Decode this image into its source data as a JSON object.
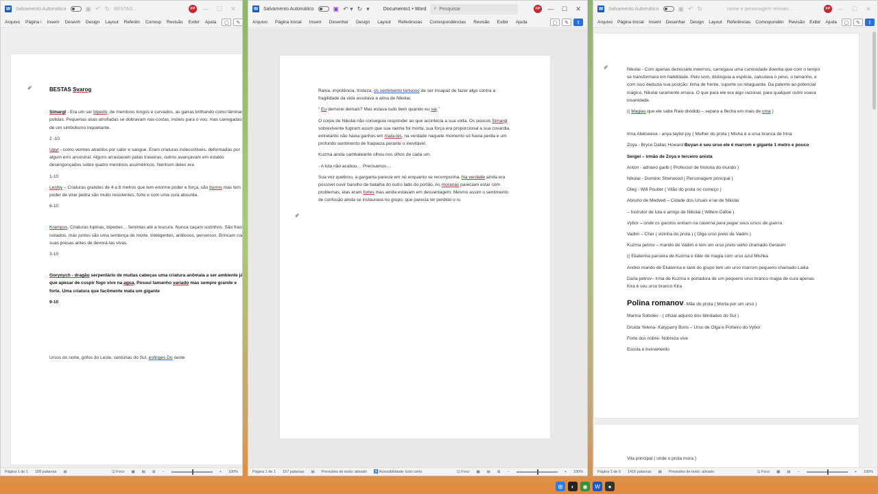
{
  "common": {
    "autosave": "Salvamento Automático",
    "avatar": "FP"
  },
  "win1": {
    "title": "BESTAS…",
    "menu": [
      "Arquivo",
      "Página i",
      "Inserir",
      "Desenh",
      "Design",
      "Layout",
      "Referên",
      "Corresp",
      "Revisão",
      "Exibir",
      "Ajuda"
    ],
    "heading": "BESTAS",
    "heading_word": "Svarog",
    "simargl_name": "Simargl",
    "simargl_a": " - Era um ser ",
    "simargl_bipedo": "bípedo",
    "simargl_b": ", de membros longos e curvados, as garras brilhando como lâminas polidas. Pequenas asas atrofiadas se dobravam nas costas, inúteis para o voo, mas carregadas de um simbolismo inquietante.",
    "simargl_range": "2 -10",
    "upyr_name": "Upyr",
    "upyr_text": " - como vermes atraídos por calor e sangue. Eram criaturas indescritíveis, deformadas por algum erro ancestral. Alguns arrastavam patas traseiras, outros avançavam em estalos desengonçados sobre quatro membros assimétricos. Nenhum deles era",
    "upyr_range": "1-10",
    "leshiy_name": "Leshiy",
    "leshiy_a": " – Criaturas grandes de 4 a 8 metros que tem enorme poder e força, são ",
    "leshiy_burros": "burros",
    "leshiy_b": " mas tem o poder de virar pedra são muito resistentes, forte e com uma cura absurda.",
    "leshiy_range": "6-10",
    "krampus_name": "Krampus",
    "krampus_text": ". Criaturas lupinas, bípedes… famintas até a loucura. Nunca caçam sozinhos. São fracos isolados, mas juntos são uma sentença de morte. Inteligentes, ardilosos, perversos. Brincam com suas presas antes de devorá-las vivas.",
    "krampus_range": "3-10",
    "gorynych_name": "Gorynych - dragão",
    "gorynych_a": " serpentário de muitas cabeças uma criatura anômala a ser ambiente já que apesar de cuspir fogo vive na ",
    "gorynych_agua": "agua",
    "gorynych_b": ". Possui tamanho ",
    "gorynych_variado": "variado",
    "gorynych_c": " mas sempre grande e forte. Uma criatura que facilmente mata um gigante",
    "gorynych_range": "9-10",
    "footer_a": "Ursos do norte, grifos do Leste, centúrias do Sul, ",
    "footer_link": "esfinges Do",
    "footer_b": " oeste",
    "status_page": "Página 1 de 1",
    "status_words": "188 palavras",
    "focus": "Foco",
    "zoom": "100%"
  },
  "win2": {
    "title": "Documento1 • Word",
    "search": "Pesquisar",
    "menu": [
      "Arquivo",
      "Página Inicial",
      "Inserir",
      "Desenhar",
      "Design",
      "Layout",
      "Referências",
      "Correspondências",
      "Revisão",
      "Exibir",
      "Ajuda"
    ],
    "p1_a": "Raiva, impotência, tristeza, ",
    "p1_link": "os sentimento tortuoso",
    "p1_b": " de ser incapaz de fazer algo contra a fragilidade da vida assolava a alma de Nikolai.",
    "p2_a": "“ ",
    "p2_eu": "Eu",
    "p2_b": " demorei demais? Mas estava tudo bem quando eu ",
    "p2_sai": "sai",
    "p2_c": ".”",
    "p3_a": "O corpo de Nikolai não conseguia responder ao que acontecia a sua volta. Os poucos ",
    "p3_simargl": "Simargl",
    "p3_b": " sobrevivente fugiram assim que sua rainha foi morta, sua força era proporcional a sua covardia, entretanto não havia ganhos em ",
    "p3_matalos": "mata-los",
    "p3_c": ", na verdade naquele momento só havia perda e um profundo sentimento de fraqueza perante o inevitável.",
    "p4": "Kuzma ainda cambaleante olhou nos olhos de cada um.",
    "p5": "- A luta não acabou… Precisamos…",
    "p6_a": "Sua voz quebrou, a garganta parecia em nó enquanto se recompunha. ",
    "p6_naverdade": "Na verdade",
    "p6_b": " ainda era possível ouvir barulho de batalha do outro lado do portão. As ",
    "p6_moranas": "moranas",
    "p6_c": " pareciam estar com problemas, elas eram ",
    "p6_fortes": "fortes",
    "p6_d": " mas ainda estavam em desvantagem. Mesmo assim o sentimento de confusão ainda se instaurava no grupo, que parecia ter perdido o ru",
    "status_page": "Página 1 de 1",
    "status_words": "157 palavras",
    "predict": "Previsões de texto: ativado",
    "access": "Acessibilidade: tudo certo",
    "focus": "Foco",
    "zoom": "100%"
  },
  "win3": {
    "title": "nome e personagem relevan…",
    "menu": [
      "Arquivo",
      "Página Inicial",
      "Inserir",
      "Desenhar",
      "Design",
      "Layout",
      "Referências",
      "Correspondên",
      "Revisão",
      "Exibir",
      "Ajuda"
    ],
    "nikolai_intro": "Nikolai - Com apenas dezessete invernos, carregava uma curiosidade doentia que com o tempo se transformara em habilidade. Pelo som, distinguia a espécie, calculava o peso, o tamanho, e com isso deduzia sua posição: linha de frente, suporte ou retaguarda. Da patente ao potencial mágico, Nikolai raramente errava. O que para ele era algo racional, para qualquer outro soava insanidade.",
    "magias_a": "(( ",
    "magias_word": "Magias",
    "magias_b": " que ele sabe Raio dividido – separa a flecha em mais de ",
    "magias_uma": "uma",
    "magias_c": " )",
    "irina": "Irina Alekseeva - anya taylor-joy  ( Mulher do prota )  Misha é a ursa branca de Irina",
    "zoya_a": "Zoya  - Bryce Dallas Howard ",
    "zoya_b": "Buyan é seu urso ele é marrom e gigante 1 metro e pouco",
    "sergei": "Sergei – irmão de Zoya e terceiro anista",
    "anton": "Anton - adriano garib ( Professor de historia do mundo )",
    "nikolai_actor": "Nikolai - Dominic Sherwood  ( Personagem principal )",
    "oleg": "Oleg - Will Poulter ( Vilão do prota no começo )",
    "abismo": "Abismo de Medved – Cidade dos Ursais e lar de Nikolai",
    "instrutor": "– Instrutor de luta e amigo de Nikolai ( Willem Dafoe )",
    "vybor": "Vybor – onde os garotos entram na caverna para pegar seus ursos de guerra",
    "vadim": "Vadim – Cher ( vizinha do prota ) ( Olga urso preto de Vadim )",
    "kuzma": "Kuzma petrov – marido de Vadim e tem um urso preto velho chamado Gerasim",
    "ekaterina": "((  Ekaterina  parceira de Kuzma e líder de magia com urso azul  Mishka",
    "andrei": "   Andrei   marido de Ekaterina e tank do grupo tem um urso marrom pequeno chamado Laika",
    "daria": " Daria petrov– Irma de Kuzma e portadora de um pequeno urso branco magia de cura apenas Kira é seu urso branco Kira",
    "polina_name": "Polina romanov",
    "polina_rest": "- Mãe do prota ( Morta por um urso )",
    "marina": "Marina Sobolev -        ( oficial adjunto dos blindados do Sul )",
    "druida": "Druida Yelena- Katyparry  Boris – Urso de Olga e Porteiro do Vybor",
    "forte": "Forte dos nobre- Nobreza vive",
    "escola": "Escola e treinamento",
    "vila": "Vila principal ( onde o prota mora )",
    "status_page": "Página 1 de 6",
    "status_words": "1416 palavras",
    "predict": "Previsões de texto: ativado",
    "focus": "Foco",
    "zoom": "100%"
  },
  "colors": {
    "word_blue": "#185abd",
    "avatar_red": "#c4262e",
    "spell_red": "#cc3333",
    "link_blue": "#2b6fd6"
  }
}
